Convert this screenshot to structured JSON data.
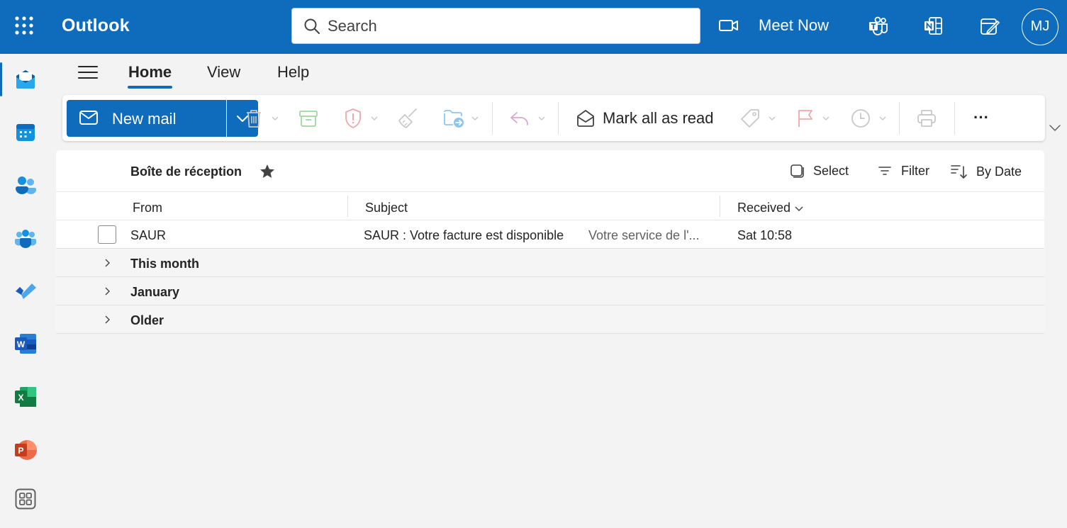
{
  "header": {
    "app_title": "Outlook",
    "search_placeholder": "Search",
    "meet_now_label": "Meet Now",
    "avatar_initials": "MJ",
    "brand_color": "#0f6cbd"
  },
  "rail": {
    "items": [
      "mail",
      "calendar",
      "people",
      "groups",
      "to-do",
      "word",
      "excel",
      "powerpoint",
      "more-apps"
    ]
  },
  "tabs": [
    {
      "label": "Home",
      "active": true
    },
    {
      "label": "View"
    },
    {
      "label": "Help"
    }
  ],
  "ribbon": {
    "new_mail_label": "New mail",
    "mark_all_read_label": "Mark all as read",
    "more_label": "···"
  },
  "list": {
    "folder_name": "Boîte de réception",
    "select_label": "Select",
    "filter_label": "Filter",
    "sort_label": "By Date",
    "columns": {
      "from": "From",
      "subject": "Subject",
      "received": "Received"
    },
    "messages": [
      {
        "from": "SAUR",
        "subject": "SAUR : Votre facture est disponible",
        "preview": "Votre service de l'...",
        "received": "Sat 10:58"
      }
    ],
    "groups": [
      {
        "label": "This month"
      },
      {
        "label": "January"
      },
      {
        "label": "Older"
      }
    ]
  }
}
